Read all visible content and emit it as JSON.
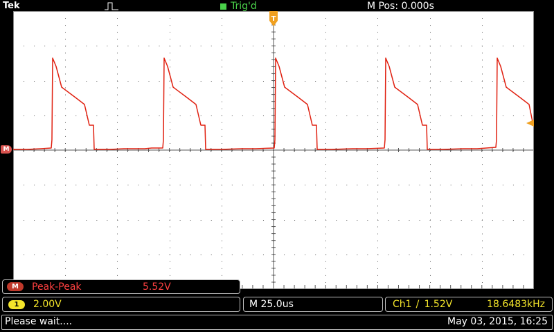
{
  "header": {
    "brand": "Tek",
    "trigger_status": "Trig'd",
    "m_position": "M Pos: 0.000s"
  },
  "markers": {
    "math_ref": "M",
    "trigger_pos": "T"
  },
  "measurement": {
    "badge": "M",
    "label": "Peak-Peak",
    "value": "5.52V"
  },
  "status": {
    "channel_badge": "1",
    "channel_scale": "2.00V",
    "timebase": "M 25.0us",
    "trigger_source": "Ch1",
    "trigger_edge": "/",
    "trigger_level": "1.52V",
    "frequency": "18.6483kHz"
  },
  "footer": {
    "message": "Please wait....",
    "timestamp": "May 03, 2015, 16:25"
  },
  "colors": {
    "trace": "#e02010",
    "graticule": "#555555",
    "trigger_marker": "#f0a020",
    "accent_yellow": "#f4e52a",
    "measure_red": "#ff4040"
  }
}
